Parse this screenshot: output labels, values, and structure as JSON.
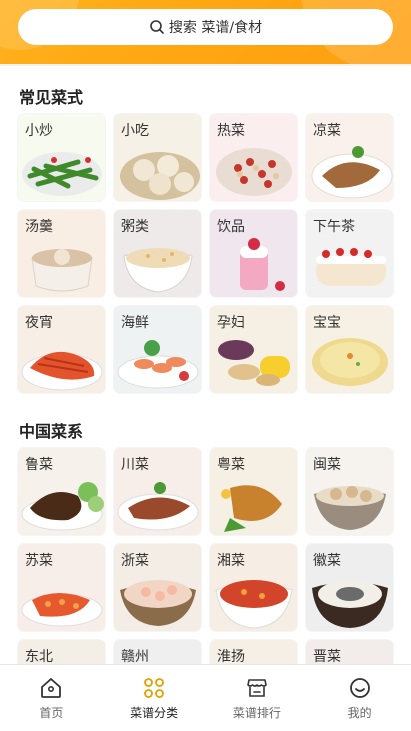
{
  "search": {
    "placeholder": "搜索 菜谱/食材"
  },
  "sections": [
    {
      "title": "常见菜式",
      "items": [
        "小炒",
        "小吃",
        "热菜",
        "凉菜",
        "汤羹",
        "粥类",
        "饮品",
        "下午茶",
        "夜宵",
        "海鲜",
        "孕妇",
        "宝宝"
      ]
    },
    {
      "title": "中国菜系",
      "items": [
        "鲁菜",
        "川菜",
        "粤菜",
        "闽菜",
        "苏菜",
        "浙菜",
        "湘菜",
        "徽菜",
        "东北",
        "赣州",
        "淮扬",
        "晋菜"
      ]
    }
  ],
  "tabs": [
    {
      "label": "首页",
      "icon": "home-icon"
    },
    {
      "label": "菜谱分类",
      "icon": "category-icon"
    },
    {
      "label": "菜谱排行",
      "icon": "ranking-icon"
    },
    {
      "label": "我的",
      "icon": "profile-icon"
    }
  ],
  "colors": {
    "accent": "#ffa812",
    "active_icon": "#e0a000"
  }
}
